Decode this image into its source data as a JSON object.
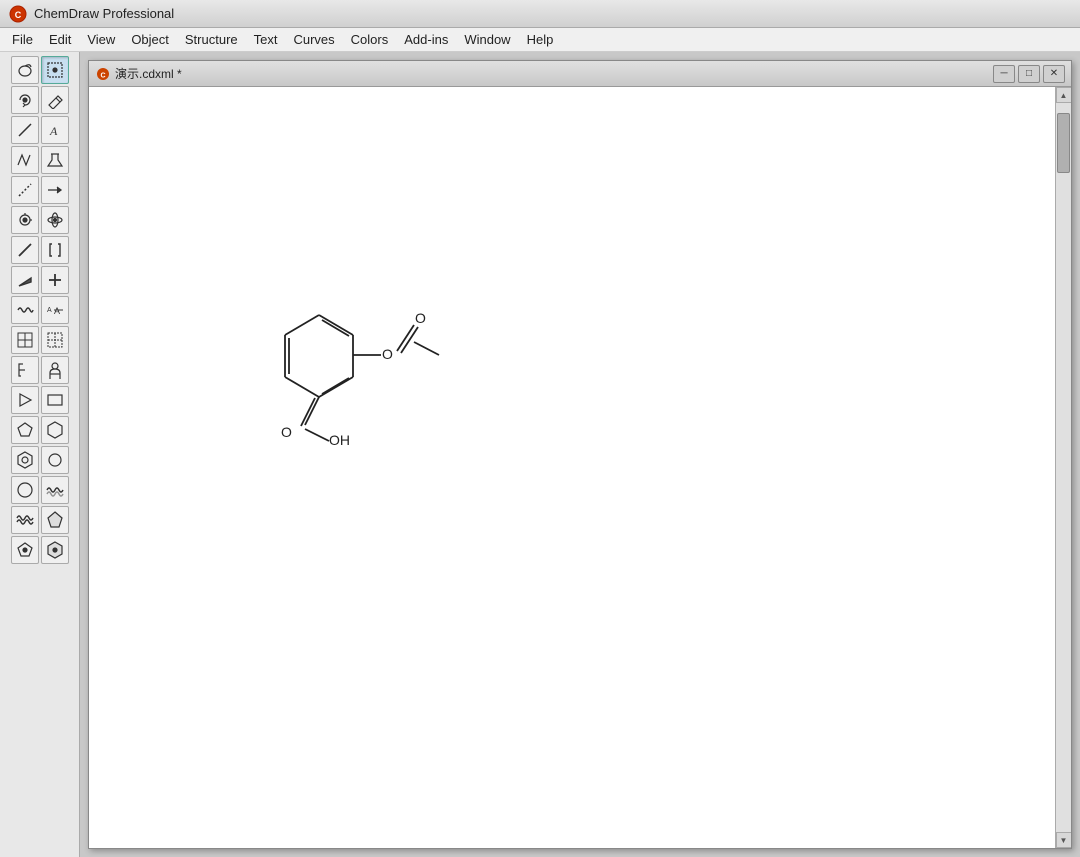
{
  "app": {
    "title": "ChemDraw Professional",
    "icon": "CD"
  },
  "menu": {
    "items": [
      "File",
      "Edit",
      "View",
      "Object",
      "Structure",
      "Text",
      "Curves",
      "Colors",
      "Add-ins",
      "Window",
      "Help"
    ]
  },
  "document": {
    "title": "演示.cdxml *",
    "icon": "CD"
  },
  "toolbar": {
    "tools": [
      {
        "id": "select-lasso",
        "label": "○",
        "icon": "lasso"
      },
      {
        "id": "select-rect",
        "label": "▭",
        "icon": "select",
        "active": true
      },
      {
        "id": "rotate",
        "label": "↻",
        "icon": "rotate"
      },
      {
        "id": "erase",
        "label": "✏",
        "icon": "erase"
      },
      {
        "id": "bond-line",
        "label": "╱",
        "icon": "bond"
      },
      {
        "id": "text",
        "label": "A",
        "icon": "text"
      },
      {
        "id": "chain",
        "label": "≈",
        "icon": "chain"
      },
      {
        "id": "flask",
        "label": "⚗",
        "icon": "flask"
      },
      {
        "id": "dash-bond",
        "label": "╌",
        "icon": "dash"
      },
      {
        "id": "arrow",
        "label": "→",
        "icon": "arrow"
      },
      {
        "id": "atom-map",
        "label": "⬡",
        "icon": "atom"
      },
      {
        "id": "bond-single",
        "label": "╲",
        "icon": "single-bond"
      },
      {
        "id": "bond-double",
        "label": "╪",
        "icon": "double-bond"
      },
      {
        "id": "bond-wedge",
        "label": "◁",
        "icon": "wedge-bond"
      },
      {
        "id": "plus",
        "label": "+",
        "icon": "plus"
      },
      {
        "id": "wavy",
        "label": "~",
        "icon": "wavy"
      },
      {
        "id": "resize",
        "label": "A↔A",
        "icon": "resize"
      },
      {
        "id": "table",
        "label": "⊞",
        "icon": "table"
      },
      {
        "id": "table-dots",
        "label": "⊡",
        "icon": "table-dots"
      },
      {
        "id": "bracket",
        "label": "↕",
        "icon": "bracket"
      },
      {
        "id": "person",
        "label": "👤",
        "icon": "person"
      },
      {
        "id": "play",
        "label": "▷",
        "icon": "play"
      },
      {
        "id": "rect-shape",
        "label": "□",
        "icon": "rect-shape"
      },
      {
        "id": "penta",
        "label": "⬠",
        "icon": "pentagon"
      },
      {
        "id": "hex",
        "label": "⬡",
        "icon": "hexagon"
      },
      {
        "id": "hex-ring",
        "label": "⬡",
        "icon": "hexring"
      },
      {
        "id": "circle-sm",
        "label": "○",
        "icon": "circle-sm"
      },
      {
        "id": "circle-lg",
        "label": "◯",
        "icon": "circle-lg"
      },
      {
        "id": "wave1",
        "label": "⌇",
        "icon": "wave1"
      },
      {
        "id": "wave2",
        "label": "〰",
        "icon": "wave2"
      },
      {
        "id": "penta-filled",
        "label": "⬟",
        "icon": "penta-filled"
      },
      {
        "id": "hex-filled",
        "label": "⬢",
        "icon": "hex-filled"
      }
    ]
  },
  "scrollbar": {
    "up_arrow": "▲",
    "down_arrow": "▼"
  },
  "doc_controls": {
    "minimize": "─",
    "restore": "□",
    "close": "✕"
  }
}
